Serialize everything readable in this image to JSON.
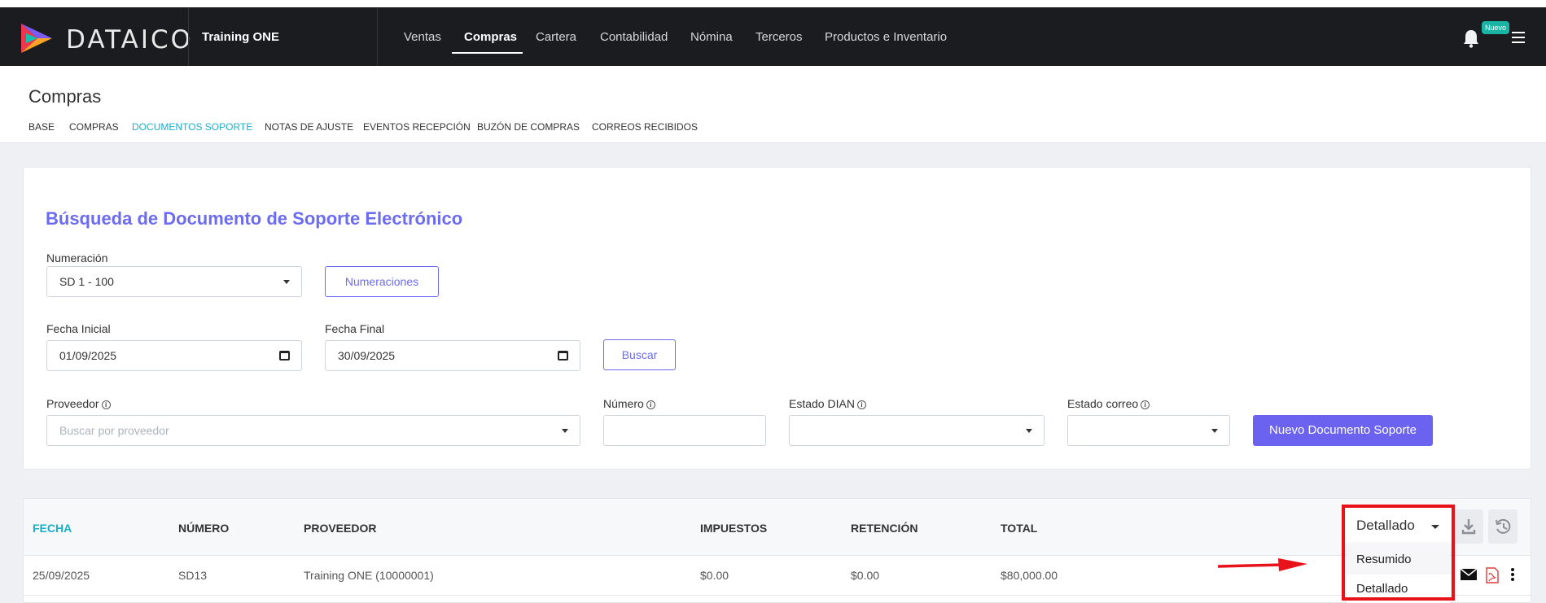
{
  "app": {
    "brand": "DATAICO",
    "company": "Training ONE",
    "badge": "Nuevo",
    "nav": [
      "Ventas",
      "Compras",
      "Cartera",
      "Contabilidad",
      "Nómina",
      "Terceros",
      "Productos e Inventario"
    ],
    "nav_active": "Compras"
  },
  "page": {
    "title": "Compras",
    "tabs": [
      "BASE",
      "COMPRAS",
      "DOCUMENTOS SOPORTE",
      "NOTAS DE AJUSTE",
      "EVENTOS RECEPCIÓN",
      "BUZÓN DE COMPRAS",
      "CORREOS RECIBIDOS"
    ],
    "tab_active": "DOCUMENTOS SOPORTE"
  },
  "search": {
    "title": "Búsqueda de Documento de Soporte Electrónico",
    "numeracion_label": "Numeración",
    "numeracion_value": "SD 1 - 100",
    "numeraciones_button": "Numeraciones",
    "fecha_inicial_label": "Fecha Inicial",
    "fecha_inicial_value": "01/09/2025",
    "fecha_final_label": "Fecha Final",
    "fecha_final_value": "30/09/2025",
    "buscar_button": "Buscar",
    "proveedor_label": "Proveedor",
    "proveedor_placeholder": "Buscar por proveedor",
    "numero_label": "Número",
    "estado_dian_label": "Estado DIAN",
    "estado_correo_label": "Estado correo",
    "nuevo_button": "Nuevo Documento Soporte"
  },
  "table": {
    "columns": [
      "FECHA",
      "NÚMERO",
      "PROVEEDOR",
      "IMPUESTOS",
      "RETENCIÓN",
      "TOTAL"
    ],
    "rows": [
      {
        "fecha": "25/09/2025",
        "numero": "SD13",
        "proveedor": "Training ONE (10000001)",
        "impuestos": "$0.00",
        "retencion": "$0.00",
        "total": "$80,000.00"
      }
    ]
  },
  "view": {
    "selected": "Detallado",
    "options": [
      "Resumido",
      "Detallado"
    ]
  },
  "icons": {
    "download": "download-icon",
    "history": "history-icon",
    "email": "email-icon",
    "pdf": "pdf-icon",
    "more": "more-vertical-icon",
    "bell": "bell-icon",
    "menu": "hamburger-menu-icon"
  },
  "colors": {
    "accent": "#6b63ef",
    "link": "#1aaecb",
    "navbar": "#1b1c1f",
    "highlight": "#e8121b"
  }
}
